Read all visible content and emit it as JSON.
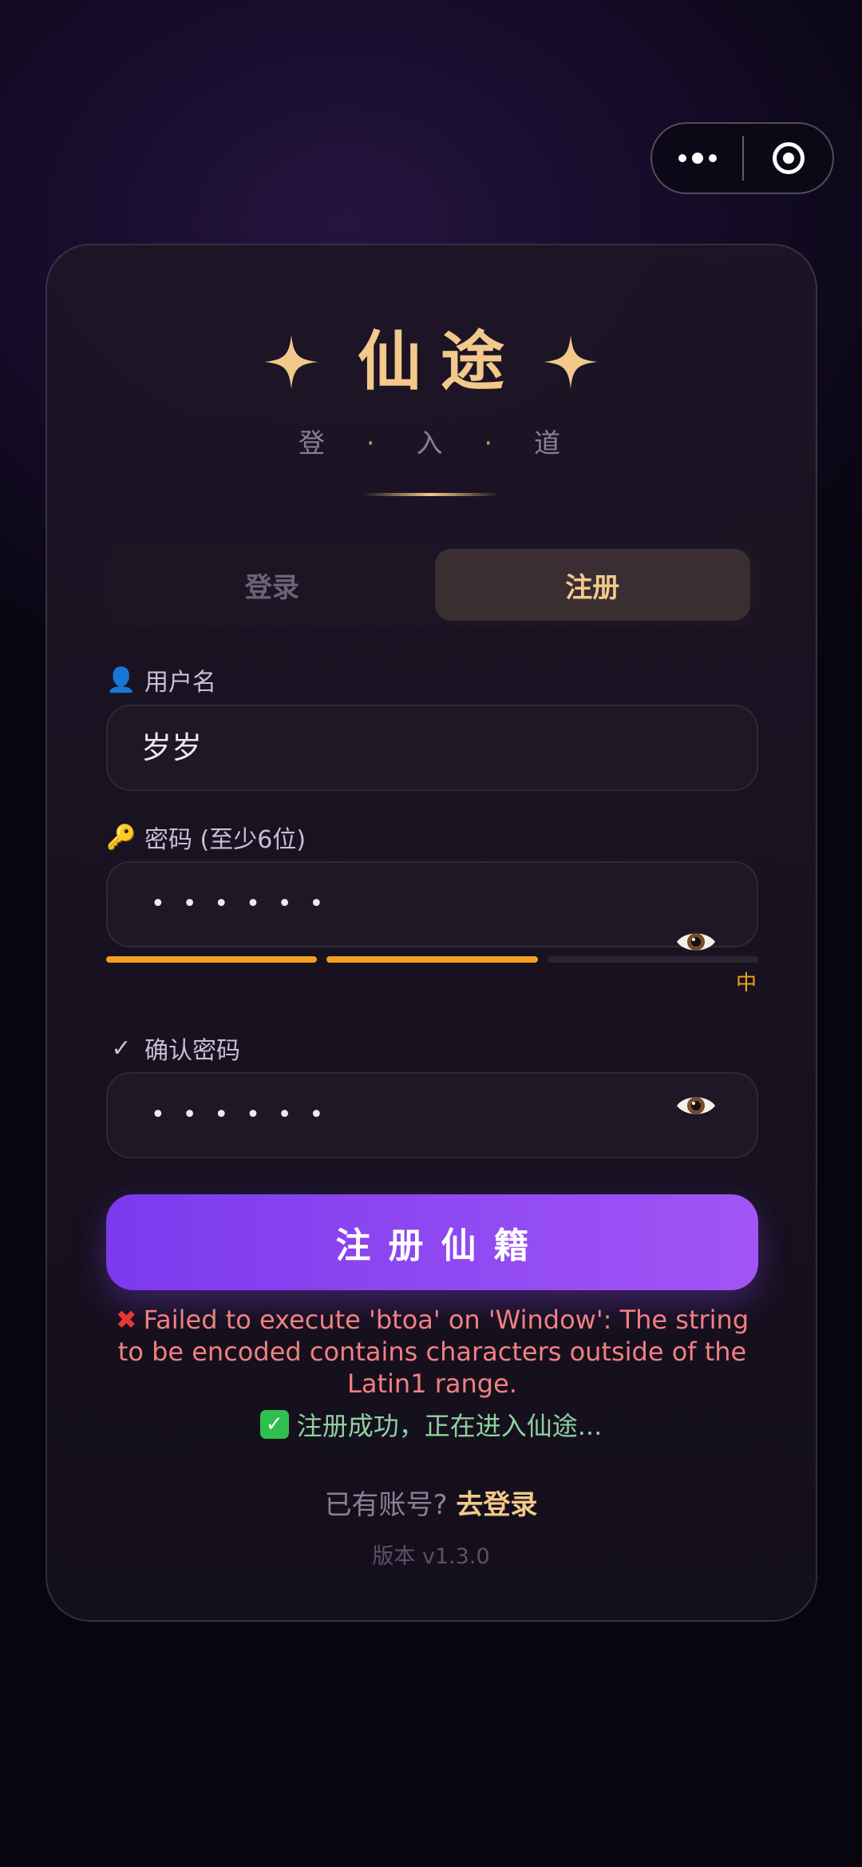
{
  "app": {
    "title": "仙途",
    "subtitle_parts": [
      "登",
      "·",
      "入",
      "·",
      "道"
    ]
  },
  "capsule": {
    "more_icon": "more-dots-icon",
    "close_icon": "target-circle-icon"
  },
  "tabs": [
    {
      "label": "登录",
      "active": false
    },
    {
      "label": "注册",
      "active": true
    }
  ],
  "form": {
    "username": {
      "icon": "👤",
      "label": "用户名",
      "value": "岁岁"
    },
    "password": {
      "icon": "🔑",
      "label": "密码 (至少6位)",
      "masked_value": "••••••",
      "strength_level": 2,
      "strength_max": 3,
      "strength_text": "中"
    },
    "confirm": {
      "icon": "✓",
      "label": "确认密码",
      "masked_value": "••••••"
    },
    "submit_label": "注册仙籍"
  },
  "messages": {
    "error_icon": "✖",
    "error_text": "Failed to execute 'btoa' on 'Window': The string to be encoded contains characters outside of the Latin1 range.",
    "success_icon": "✓",
    "success_text": "注册成功，正在进入仙途..."
  },
  "footer": {
    "have_account": "已有账号?",
    "login_link": "去登录",
    "version": "版本 v1.3.0"
  },
  "colors": {
    "gold": "#f2c98a",
    "purple_start": "#7c3aed",
    "purple_end": "#a155f6",
    "strength": "#f4a01e",
    "error": "#f08080",
    "success": "#8fd19e"
  }
}
